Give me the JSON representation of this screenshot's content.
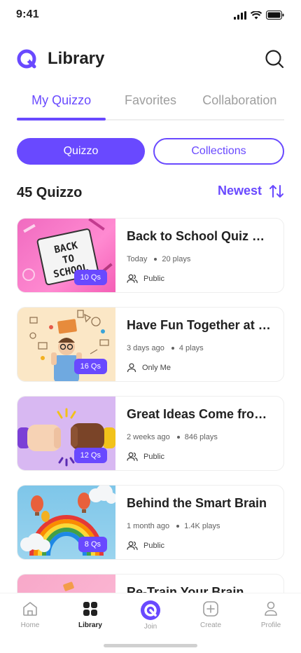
{
  "status": {
    "time": "9:41"
  },
  "header": {
    "title": "Library",
    "logo_icon": "quizzo-logo-icon",
    "search_icon": "search-icon"
  },
  "tabs": [
    {
      "label": "My Quizzo",
      "active": true
    },
    {
      "label": "Favorites",
      "active": false
    },
    {
      "label": "Collaboration",
      "active": false
    }
  ],
  "segments": {
    "quizzo_label": "Quizzo",
    "collections_label": "Collections"
  },
  "list_header": {
    "count": "45 Quizzo",
    "sort_label": "Newest",
    "sort_icon": "sort-icon"
  },
  "quizzes": [
    {
      "title": "Back to School Quiz Game",
      "badge": "10 Qs",
      "time": "Today",
      "plays": "20 plays",
      "visibility": "Public",
      "visibility_icon": "users-icon"
    },
    {
      "title": "Have Fun Together at School",
      "badge": "16 Qs",
      "time": "3 days ago",
      "plays": "4 plays",
      "visibility": "Only Me",
      "visibility_icon": "user-icon"
    },
    {
      "title": "Great Ideas Come from Teamwork",
      "badge": "12 Qs",
      "time": "2 weeks ago",
      "plays": "846 plays",
      "visibility": "Public",
      "visibility_icon": "users-icon"
    },
    {
      "title": "Behind the Smart Brain",
      "badge": "8 Qs",
      "time": "1 month ago",
      "plays": "1.4K plays",
      "visibility": "Public",
      "visibility_icon": "users-icon"
    },
    {
      "title": "Re-Train Your Brain",
      "badge": "",
      "time": "",
      "plays": "",
      "visibility": "",
      "visibility_icon": "users-icon"
    }
  ],
  "bottom_nav": [
    {
      "label": "Home",
      "icon": "home-icon",
      "active": false
    },
    {
      "label": "Library",
      "icon": "grid-icon",
      "active": true
    },
    {
      "label": "Join",
      "icon": "join-icon",
      "active": false
    },
    {
      "label": "Create",
      "icon": "plus-square-icon",
      "active": false
    },
    {
      "label": "Profile",
      "icon": "profile-icon",
      "active": false
    }
  ],
  "colors": {
    "accent": "#6949ff",
    "text": "#212121",
    "muted": "#9e9e9e"
  }
}
